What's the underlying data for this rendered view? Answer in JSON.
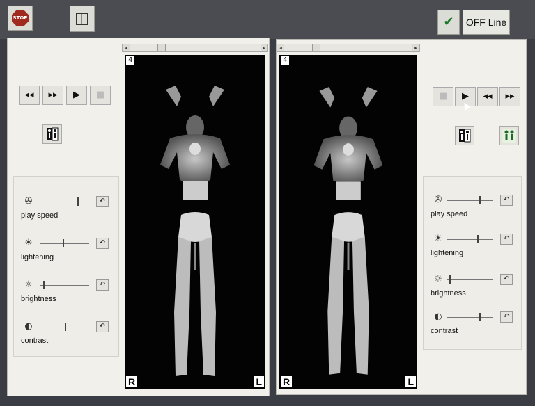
{
  "toolbar": {
    "stop_label": "STOP",
    "online_status_label": "OFF Line",
    "check_icon": "check-icon",
    "layout_icon": "layout-grid-icon"
  },
  "left_panel": {
    "frame_number": "4",
    "right_marker": "R",
    "left_marker": "L",
    "adjustments": {
      "play_speed": {
        "label": "play speed",
        "level": 0.75
      },
      "lightening": {
        "label": "lightening",
        "level": 0.45
      },
      "brightness": {
        "label": "brightness",
        "level": 0.05
      },
      "contrast": {
        "label": "contrast",
        "level": 0.5
      }
    }
  },
  "right_panel": {
    "frame_number": "4",
    "right_marker": "R",
    "left_marker": "L",
    "adjustments": {
      "play_speed": {
        "label": "play speed",
        "level": 0.7
      },
      "lightening": {
        "label": "lightening",
        "level": 0.65
      },
      "brightness": {
        "label": "brightness",
        "level": 0.05
      },
      "contrast": {
        "label": "contrast",
        "level": 0.7
      }
    }
  }
}
